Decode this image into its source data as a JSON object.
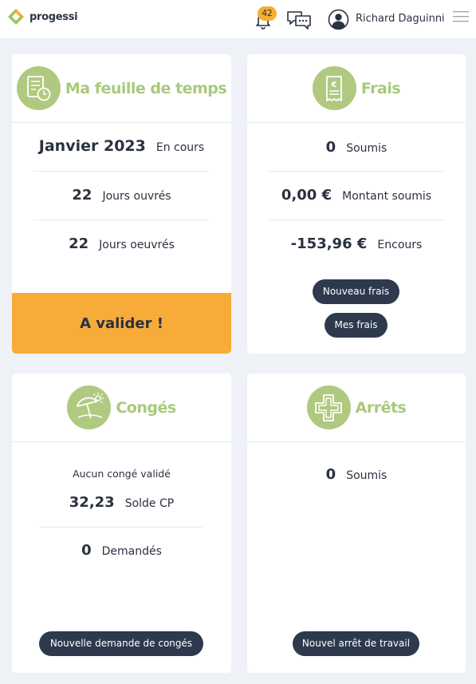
{
  "header": {
    "logo_text": "progessi",
    "notifications_count": "42",
    "user_name": "Richard Daguinni"
  },
  "timesheet": {
    "title": "Ma feuille de temps",
    "period": "Janvier 2023",
    "period_status": "En cours",
    "working_days_value": "22",
    "working_days_label": "Jours ouvrés",
    "worked_days_value": "22",
    "worked_days_label": "Jours oeuvrés",
    "validate_label": "A valider !"
  },
  "expenses": {
    "title": "Frais",
    "submitted_value": "0",
    "submitted_label": "Soumis",
    "amount_value": "0,00 €",
    "amount_label": "Montant soumis",
    "pending_value": "-153,96 €",
    "pending_label": "Encours",
    "new_button": "Nouveau frais",
    "mine_button": "Mes frais"
  },
  "leaves": {
    "title": "Congés",
    "note": "Aucun congé validé",
    "balance_value": "32,23",
    "balance_label": "Solde CP",
    "requested_value": "0",
    "requested_label": "Demandés",
    "new_button": "Nouvelle demande de congés"
  },
  "sick_leaves": {
    "title": "Arrêts",
    "submitted_value": "0",
    "submitted_label": "Soumis",
    "new_button": "Nouvel arrêt de travail"
  },
  "colors": {
    "accent_green": "#a9c97c",
    "icon_green": "#b0c981",
    "validate_orange": "#f7ac3a",
    "badge_orange": "#f5ad33",
    "button_dark": "#2d3a4e",
    "background": "#eef1f6"
  }
}
